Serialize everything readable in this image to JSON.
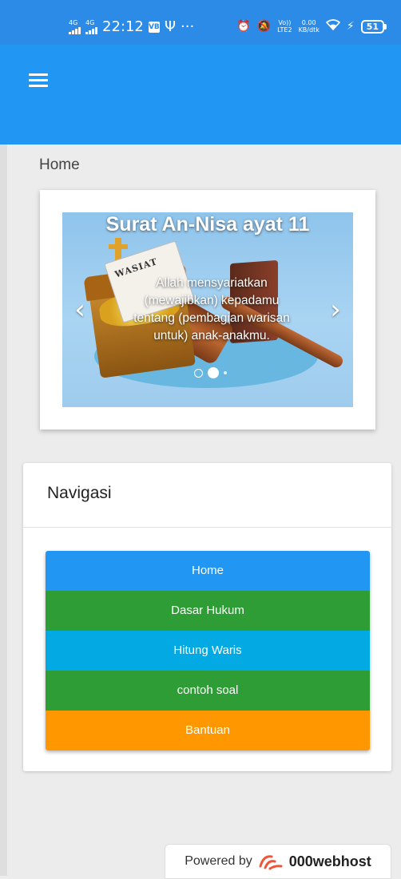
{
  "status_bar": {
    "net1": "4G",
    "net2": "4G",
    "time": "22:12",
    "app_icon_text": "VB",
    "dots": "···",
    "volte_top": "Vo))",
    "volte_bottom": "LTE2",
    "speed_top": "0.00",
    "speed_bottom": "KB/dtk",
    "battery": "51"
  },
  "breadcrumb": "Home",
  "carousel": {
    "title": "Surat An-Nisa ayat 11",
    "caption": "Allah mensyariatkan (mewajibkan) kepadamu tentang (pembagian warisan untuk) anak-anakmu.",
    "image_text": "WASIAT",
    "prev": "‹",
    "next": "›"
  },
  "navigation": {
    "heading": "Navigasi",
    "items": [
      {
        "label": "Home",
        "color": "#2196f3"
      },
      {
        "label": "Dasar Hukum",
        "color": "#2e9d35"
      },
      {
        "label": "Hitung Waris",
        "color": "#03a9e2"
      },
      {
        "label": "contoh soal",
        "color": "#2e9d35"
      },
      {
        "label": "Bantuan",
        "color": "#ff9800"
      }
    ]
  },
  "footer": {
    "powered_by": "Powered by",
    "brand": "000webhost"
  },
  "colors": {
    "status_bar": "#2b8be6",
    "app_bar": "#2196f3",
    "page_bg": "#ececec"
  }
}
